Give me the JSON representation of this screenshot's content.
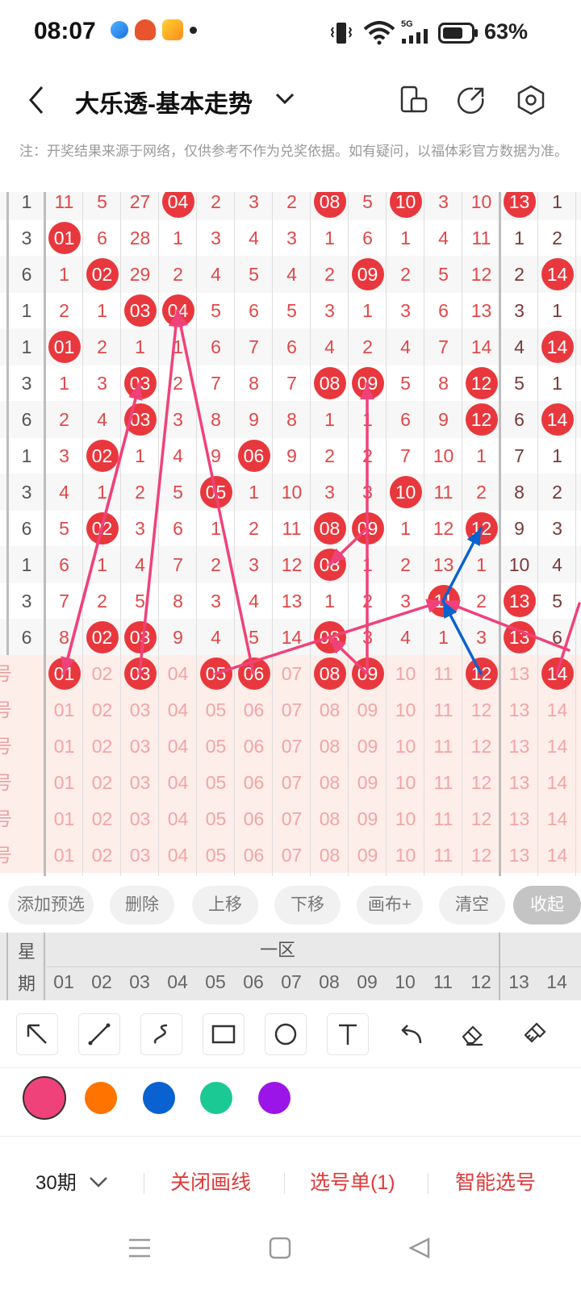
{
  "status_bar": {
    "time": "08:07",
    "battery": "63%",
    "network": "5G"
  },
  "header": {
    "title": "大乐透-基本走势"
  },
  "notice": "注：开奖结果来源于网络，仅供参考不作为兑奖依据。如有疑问，以福体彩官方数据为准。",
  "trend_rows": [
    {
      "week": "1",
      "cells": [
        {
          "v": "11",
          "b": false
        },
        {
          "v": "5",
          "b": false
        },
        {
          "v": "27",
          "b": false
        },
        {
          "v": "04",
          "b": true
        },
        {
          "v": "2",
          "b": false
        },
        {
          "v": "3",
          "b": false
        },
        {
          "v": "2",
          "b": false
        },
        {
          "v": "08",
          "b": true
        },
        {
          "v": "5",
          "b": false
        },
        {
          "v": "10",
          "b": true
        },
        {
          "v": "3",
          "b": false
        },
        {
          "v": "10",
          "b": false
        },
        {
          "v": "13",
          "b": true
        },
        {
          "v": "1",
          "b": false
        }
      ]
    },
    {
      "week": "3",
      "cells": [
        {
          "v": "01",
          "b": true
        },
        {
          "v": "6",
          "b": false
        },
        {
          "v": "28",
          "b": false
        },
        {
          "v": "1",
          "b": false
        },
        {
          "v": "3",
          "b": false
        },
        {
          "v": "4",
          "b": false
        },
        {
          "v": "3",
          "b": false
        },
        {
          "v": "1",
          "b": false
        },
        {
          "v": "6",
          "b": false
        },
        {
          "v": "1",
          "b": false
        },
        {
          "v": "4",
          "b": false
        },
        {
          "v": "11",
          "b": false
        },
        {
          "v": "1",
          "b": false
        },
        {
          "v": "2",
          "b": false
        }
      ]
    },
    {
      "week": "6",
      "cells": [
        {
          "v": "1",
          "b": false
        },
        {
          "v": "02",
          "b": true
        },
        {
          "v": "29",
          "b": false
        },
        {
          "v": "2",
          "b": false
        },
        {
          "v": "4",
          "b": false
        },
        {
          "v": "5",
          "b": false
        },
        {
          "v": "4",
          "b": false
        },
        {
          "v": "2",
          "b": false
        },
        {
          "v": "09",
          "b": true
        },
        {
          "v": "2",
          "b": false
        },
        {
          "v": "5",
          "b": false
        },
        {
          "v": "12",
          "b": false
        },
        {
          "v": "2",
          "b": false
        },
        {
          "v": "14",
          "b": true
        }
      ]
    },
    {
      "week": "1",
      "cells": [
        {
          "v": "2",
          "b": false
        },
        {
          "v": "1",
          "b": false
        },
        {
          "v": "03",
          "b": true
        },
        {
          "v": "04",
          "b": true
        },
        {
          "v": "5",
          "b": false
        },
        {
          "v": "6",
          "b": false
        },
        {
          "v": "5",
          "b": false
        },
        {
          "v": "3",
          "b": false
        },
        {
          "v": "1",
          "b": false
        },
        {
          "v": "3",
          "b": false
        },
        {
          "v": "6",
          "b": false
        },
        {
          "v": "13",
          "b": false
        },
        {
          "v": "3",
          "b": false
        },
        {
          "v": "1",
          "b": false
        }
      ]
    },
    {
      "week": "1",
      "cells": [
        {
          "v": "01",
          "b": true
        },
        {
          "v": "2",
          "b": false
        },
        {
          "v": "1",
          "b": false
        },
        {
          "v": "1",
          "b": false
        },
        {
          "v": "6",
          "b": false
        },
        {
          "v": "7",
          "b": false
        },
        {
          "v": "6",
          "b": false
        },
        {
          "v": "4",
          "b": false
        },
        {
          "v": "2",
          "b": false
        },
        {
          "v": "4",
          "b": false
        },
        {
          "v": "7",
          "b": false
        },
        {
          "v": "14",
          "b": false
        },
        {
          "v": "4",
          "b": false
        },
        {
          "v": "14",
          "b": true
        }
      ]
    },
    {
      "week": "3",
      "cells": [
        {
          "v": "1",
          "b": false
        },
        {
          "v": "3",
          "b": false
        },
        {
          "v": "03",
          "b": true
        },
        {
          "v": "2",
          "b": false
        },
        {
          "v": "7",
          "b": false
        },
        {
          "v": "8",
          "b": false
        },
        {
          "v": "7",
          "b": false
        },
        {
          "v": "08",
          "b": true
        },
        {
          "v": "09",
          "b": true
        },
        {
          "v": "5",
          "b": false
        },
        {
          "v": "8",
          "b": false
        },
        {
          "v": "12",
          "b": true
        },
        {
          "v": "5",
          "b": false
        },
        {
          "v": "1",
          "b": false
        }
      ]
    },
    {
      "week": "6",
      "cells": [
        {
          "v": "2",
          "b": false
        },
        {
          "v": "4",
          "b": false
        },
        {
          "v": "03",
          "b": true
        },
        {
          "v": "3",
          "b": false
        },
        {
          "v": "8",
          "b": false
        },
        {
          "v": "9",
          "b": false
        },
        {
          "v": "8",
          "b": false
        },
        {
          "v": "1",
          "b": false
        },
        {
          "v": "1",
          "b": false
        },
        {
          "v": "6",
          "b": false
        },
        {
          "v": "9",
          "b": false
        },
        {
          "v": "12",
          "b": true
        },
        {
          "v": "6",
          "b": false
        },
        {
          "v": "14",
          "b": true
        }
      ]
    },
    {
      "week": "1",
      "cells": [
        {
          "v": "3",
          "b": false
        },
        {
          "v": "02",
          "b": true
        },
        {
          "v": "1",
          "b": false
        },
        {
          "v": "4",
          "b": false
        },
        {
          "v": "9",
          "b": false
        },
        {
          "v": "06",
          "b": true
        },
        {
          "v": "9",
          "b": false
        },
        {
          "v": "2",
          "b": false
        },
        {
          "v": "2",
          "b": false
        },
        {
          "v": "7",
          "b": false
        },
        {
          "v": "10",
          "b": false
        },
        {
          "v": "1",
          "b": false
        },
        {
          "v": "7",
          "b": false
        },
        {
          "v": "1",
          "b": false
        }
      ]
    },
    {
      "week": "3",
      "cells": [
        {
          "v": "4",
          "b": false
        },
        {
          "v": "1",
          "b": false
        },
        {
          "v": "2",
          "b": false
        },
        {
          "v": "5",
          "b": false
        },
        {
          "v": "05",
          "b": true
        },
        {
          "v": "1",
          "b": false
        },
        {
          "v": "10",
          "b": false
        },
        {
          "v": "3",
          "b": false
        },
        {
          "v": "3",
          "b": false
        },
        {
          "v": "10",
          "b": true
        },
        {
          "v": "11",
          "b": false
        },
        {
          "v": "2",
          "b": false
        },
        {
          "v": "8",
          "b": false
        },
        {
          "v": "2",
          "b": false
        }
      ]
    },
    {
      "week": "6",
      "cells": [
        {
          "v": "5",
          "b": false
        },
        {
          "v": "02",
          "b": true
        },
        {
          "v": "3",
          "b": false
        },
        {
          "v": "6",
          "b": false
        },
        {
          "v": "1",
          "b": false
        },
        {
          "v": "2",
          "b": false
        },
        {
          "v": "11",
          "b": false
        },
        {
          "v": "08",
          "b": true
        },
        {
          "v": "09",
          "b": true
        },
        {
          "v": "1",
          "b": false
        },
        {
          "v": "12",
          "b": false
        },
        {
          "v": "12",
          "b": true
        },
        {
          "v": "9",
          "b": false
        },
        {
          "v": "3",
          "b": false
        }
      ]
    },
    {
      "week": "1",
      "cells": [
        {
          "v": "6",
          "b": false
        },
        {
          "v": "1",
          "b": false
        },
        {
          "v": "4",
          "b": false
        },
        {
          "v": "7",
          "b": false
        },
        {
          "v": "2",
          "b": false
        },
        {
          "v": "3",
          "b": false
        },
        {
          "v": "12",
          "b": false
        },
        {
          "v": "08",
          "b": true
        },
        {
          "v": "1",
          "b": false
        },
        {
          "v": "2",
          "b": false
        },
        {
          "v": "13",
          "b": false
        },
        {
          "v": "1",
          "b": false
        },
        {
          "v": "10",
          "b": false
        },
        {
          "v": "4",
          "b": false
        }
      ]
    },
    {
      "week": "3",
      "cells": [
        {
          "v": "7",
          "b": false
        },
        {
          "v": "2",
          "b": false
        },
        {
          "v": "5",
          "b": false
        },
        {
          "v": "8",
          "b": false
        },
        {
          "v": "3",
          "b": false
        },
        {
          "v": "4",
          "b": false
        },
        {
          "v": "13",
          "b": false
        },
        {
          "v": "1",
          "b": false
        },
        {
          "v": "2",
          "b": false
        },
        {
          "v": "3",
          "b": false
        },
        {
          "v": "11",
          "b": true
        },
        {
          "v": "2",
          "b": false
        },
        {
          "v": "13",
          "b": true
        },
        {
          "v": "5",
          "b": false
        }
      ]
    },
    {
      "week": "6",
      "cells": [
        {
          "v": "8",
          "b": false
        },
        {
          "v": "02",
          "b": true
        },
        {
          "v": "03",
          "b": true
        },
        {
          "v": "9",
          "b": false
        },
        {
          "v": "4",
          "b": false
        },
        {
          "v": "5",
          "b": false
        },
        {
          "v": "14",
          "b": false
        },
        {
          "v": "08",
          "b": true
        },
        {
          "v": "3",
          "b": false
        },
        {
          "v": "4",
          "b": false
        },
        {
          "v": "1",
          "b": false
        },
        {
          "v": "3",
          "b": false
        },
        {
          "v": "13",
          "b": true
        },
        {
          "v": "6",
          "b": false
        }
      ]
    }
  ],
  "pick_rows": [
    {
      "label": "号",
      "selected": [
        "01",
        "03",
        "05",
        "06",
        "08",
        "09",
        "12",
        "14"
      ]
    },
    {
      "label": "号",
      "selected": []
    },
    {
      "label": "号",
      "selected": []
    },
    {
      "label": "号",
      "selected": []
    },
    {
      "label": "号",
      "selected": []
    },
    {
      "label": "号",
      "selected": []
    }
  ],
  "numbers": [
    "01",
    "02",
    "03",
    "04",
    "05",
    "06",
    "07",
    "08",
    "09",
    "10",
    "11",
    "12",
    "13",
    "14"
  ],
  "actions": [
    "添加预选",
    "删除",
    "上移",
    "下移",
    "画布+",
    "清空",
    "收起"
  ],
  "period_header": {
    "week_label": [
      "星",
      "期"
    ],
    "zone_label": "一区"
  },
  "tools": [
    {
      "name": "arrow-tool-icon"
    },
    {
      "name": "line-tool-icon"
    },
    {
      "name": "freehand-tool-icon"
    },
    {
      "name": "rectangle-tool-icon"
    },
    {
      "name": "circle-tool-icon"
    },
    {
      "name": "text-tool-icon"
    },
    {
      "name": "undo-icon"
    },
    {
      "name": "eraser-icon"
    },
    {
      "name": "clear-brush-icon"
    }
  ],
  "colors": {
    "pink": "#f0427a",
    "orange": "#ff7300",
    "blue": "#0a62d0",
    "green": "#1bc994",
    "purple": "#9b15e8"
  },
  "accent_red": "#e8383d",
  "bottom": {
    "period": "30期",
    "close_lines": "关闭画线",
    "pick_list": "选号单(1)",
    "smart_pick": "智能选号"
  }
}
